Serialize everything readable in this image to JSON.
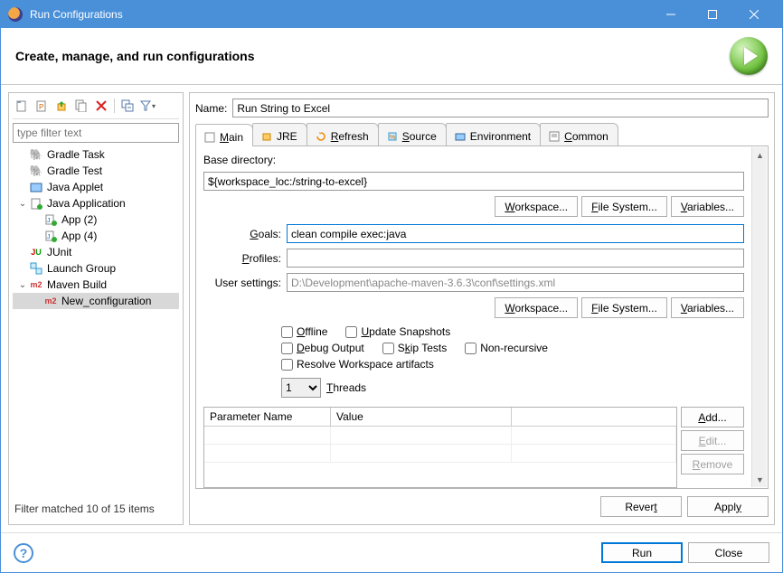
{
  "window": {
    "title": "Run Configurations"
  },
  "header": {
    "headline": "Create, manage, and run configurations"
  },
  "left": {
    "filter_placeholder": "type filter text",
    "matched": "Filter matched 10 of 15 items",
    "tree": [
      {
        "label": "Gradle Task",
        "icon": "gradle"
      },
      {
        "label": "Gradle Test",
        "icon": "gradle"
      },
      {
        "label": "Java Applet",
        "icon": "applet"
      },
      {
        "label": "Java Application",
        "icon": "javaapp",
        "exp": true,
        "children": [
          {
            "label": "App (2)",
            "icon": "javaapp-run"
          },
          {
            "label": "App (4)",
            "icon": "javaapp-run"
          }
        ]
      },
      {
        "label": "JUnit",
        "icon": "junit"
      },
      {
        "label": "Launch Group",
        "icon": "launchgrp"
      },
      {
        "label": "Maven Build",
        "icon": "maven",
        "exp": true,
        "children": [
          {
            "label": "New_configuration",
            "icon": "maven",
            "selected": true
          }
        ]
      }
    ]
  },
  "name_label": "Name:",
  "name_value": "Run String to Excel",
  "tabs": [
    {
      "label": "Main",
      "active": true
    },
    {
      "label": "JRE"
    },
    {
      "label": "Refresh"
    },
    {
      "label": "Source"
    },
    {
      "label": "Environment"
    },
    {
      "label": "Common"
    }
  ],
  "main": {
    "base_dir_label": "Base directory:",
    "base_dir_value": "${workspace_loc:/string-to-excel}",
    "goals_label": "Goals:",
    "goals_value": "clean compile exec:java",
    "profiles_label": "Profiles:",
    "profiles_value": "",
    "usersettings_label": "User settings:",
    "usersettings_value": "D:\\Development\\apache-maven-3.6.3\\conf\\settings.xml",
    "btn_workspace": "Workspace...",
    "btn_filesystem": "File System...",
    "btn_variables": "Variables...",
    "ck_offline": "Offline",
    "ck_update": "Update Snapshots",
    "ck_debug": "Debug Output",
    "ck_skip": "Skip Tests",
    "ck_nonrec": "Non-recursive",
    "ck_resolve": "Resolve Workspace artifacts",
    "threads_label": "Threads",
    "threads_value": "1",
    "table": {
      "col1": "Parameter Name",
      "col2": "Value",
      "btn_add": "Add...",
      "btn_edit": "Edit...",
      "btn_remove": "Remove"
    },
    "btn_revert": "Revert",
    "btn_apply": "Apply"
  },
  "footer": {
    "run": "Run",
    "close": "Close"
  }
}
